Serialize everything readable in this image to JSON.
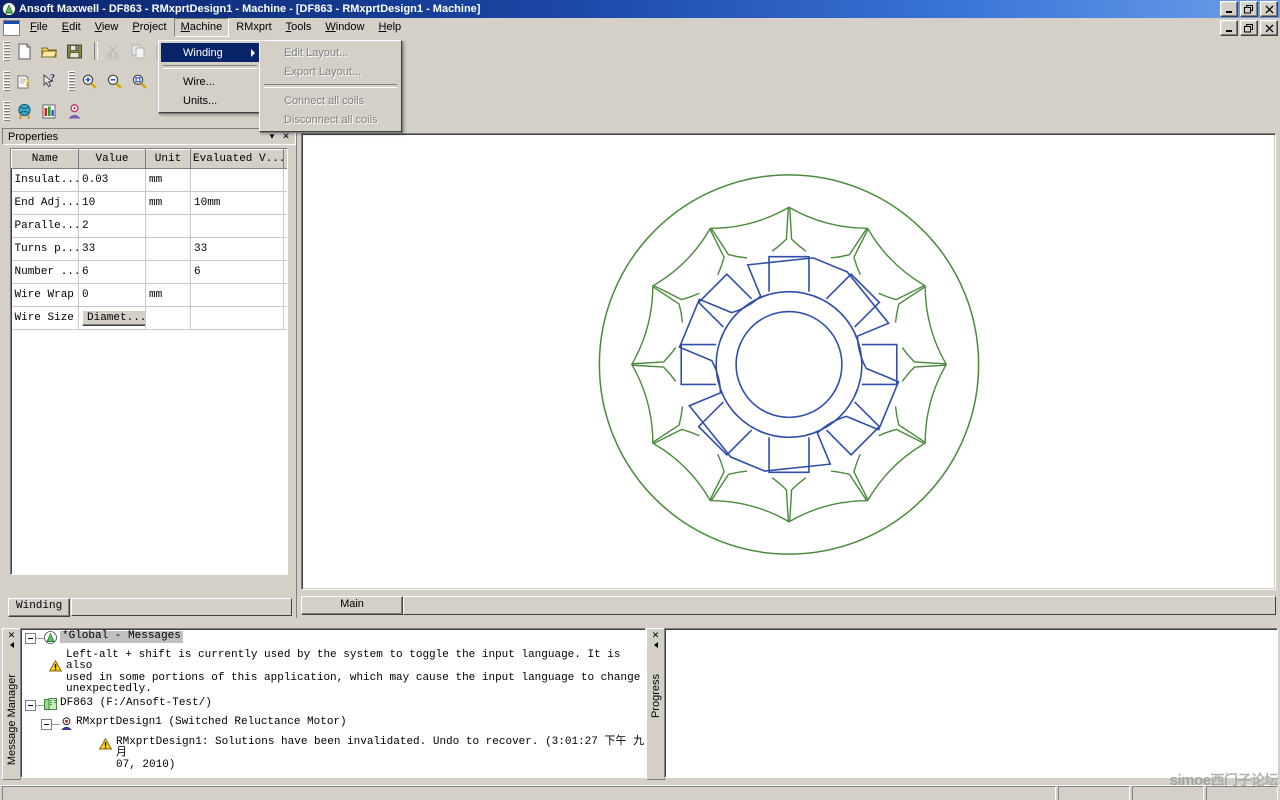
{
  "window": {
    "title": "Ansoft Maxwell - DF863 - RMxprtDesign1 - Machine - [DF863 - RMxprtDesign1 - Machine]",
    "app_icon": "ansoft-maxwell-icon",
    "minimize": "_",
    "maximize": "❐",
    "close": "✕"
  },
  "mdi": {
    "minimize": "_",
    "restore": "❐",
    "close": "✕",
    "doc_icon": "document-icon"
  },
  "menubar": {
    "items": [
      {
        "label": "File",
        "accel": "F",
        "state": "normal"
      },
      {
        "label": "Edit",
        "accel": "E",
        "state": "normal"
      },
      {
        "label": "View",
        "accel": "V",
        "state": "normal"
      },
      {
        "label": "Project",
        "accel": "P",
        "state": "normal"
      },
      {
        "label": "Machine",
        "accel": "M",
        "state": "open"
      },
      {
        "label": "RMxprt",
        "accel": "R",
        "state": "normal"
      },
      {
        "label": "Tools",
        "accel": "T",
        "state": "normal"
      },
      {
        "label": "Window",
        "accel": "W",
        "state": "normal"
      },
      {
        "label": "Help",
        "accel": "H",
        "state": "normal"
      }
    ]
  },
  "machine_menu": {
    "items": [
      {
        "label": "Winding",
        "selected": true,
        "has_submenu": true,
        "disabled": false
      },
      {
        "separator": true
      },
      {
        "label": "Wire...",
        "selected": false,
        "has_submenu": false,
        "disabled": false
      },
      {
        "label": "Units...",
        "selected": false,
        "has_submenu": false,
        "disabled": false
      }
    ]
  },
  "winding_submenu": {
    "items": [
      {
        "label": "Edit Layout...",
        "disabled": true
      },
      {
        "label": "Export Layout...",
        "disabled": true
      },
      {
        "separator": true
      },
      {
        "label": "Connect all coils",
        "disabled": true
      },
      {
        "label": "Disconnect all coils",
        "disabled": true
      }
    ]
  },
  "toolbars": {
    "row1": [
      {
        "group": 1,
        "icons": [
          "new-document-icon",
          "open-folder-icon",
          "save-disk-icon"
        ]
      },
      {
        "group": 2,
        "icons": [
          "cut-scissors-icon",
          "copy-icon",
          "paste-icon"
        ]
      }
    ],
    "row2": [
      {
        "group": 1,
        "icons": [
          "help-context-icon",
          "help-pointer-icon"
        ]
      },
      {
        "group": 2,
        "icons": [
          "zoom-in-icon",
          "zoom-out-icon",
          "zoom-fit-icon"
        ]
      },
      {
        "group": 3,
        "icons": [
          "validate-check-icon",
          "analyze-icon",
          "analyze-all-icon",
          "edit-notes-icon",
          "copy-report-icon",
          "flag-icon"
        ]
      }
    ],
    "row3": [
      {
        "group": 1,
        "icons": [
          "model-icon",
          "results-icon",
          "user-defined-icon"
        ]
      }
    ]
  },
  "properties": {
    "caption": "Properties",
    "collapse_glyph": "▾",
    "close_glyph": "✕",
    "columns": [
      "Name",
      "Value",
      "Unit",
      "Evaluated V..."
    ],
    "rows": [
      {
        "name": "Insulat...",
        "value": "0.03",
        "unit": "mm",
        "evaluated": "",
        "is_button": false
      },
      {
        "name": "End Adj...",
        "value": "10",
        "unit": "mm",
        "evaluated": "10mm",
        "is_button": false
      },
      {
        "name": "Paralle...",
        "value": "2",
        "unit": "",
        "evaluated": "",
        "is_button": false
      },
      {
        "name": "Turns p...",
        "value": "33",
        "unit": "",
        "evaluated": "33",
        "is_button": false
      },
      {
        "name": "Number ...",
        "value": "6",
        "unit": "",
        "evaluated": "6",
        "is_button": false
      },
      {
        "name": "Wire Wrap",
        "value": "0",
        "unit": "mm",
        "evaluated": "",
        "is_button": false
      },
      {
        "name": "Wire Size",
        "value": "Diamet...",
        "unit": "",
        "evaluated": "",
        "is_button": true
      }
    ],
    "tab": "Winding"
  },
  "document": {
    "tab": "Main",
    "drawing": {
      "name": "switched-reluctance-motor-cross-section",
      "stator_color": "#4a8a3c",
      "rotor_color": "#2f4fa8",
      "background": "#ffffff",
      "stator_teeth": 12,
      "rotor_poles": 8,
      "outer_radius": 190,
      "stator_yoke_inner_radius": 152,
      "stator_bore_radius": 112,
      "rotor_outer_radius": 108,
      "rotor_pole_radius": 73,
      "shaft_radius": 53
    }
  },
  "message_manager": {
    "side_label": "Message Manager",
    "close_glyph": "✕",
    "tree": [
      {
        "level": 0,
        "type": "root",
        "icon": "ansoft-globe-icon",
        "label": "*Global - Messages",
        "selected": true
      },
      {
        "level": 1,
        "type": "warning",
        "icon": "warning-triangle-icon",
        "lines": [
          "Left-alt + shift is currently used by the system to toggle the input language. It is also",
          "used in some portions of this application, which may cause the input language to change",
          "unexpectedly."
        ]
      },
      {
        "level": 0,
        "type": "project",
        "icon": "project-icon",
        "label": "DF863 (F:/Ansoft-Test/)",
        "selected": false
      },
      {
        "level": 1,
        "type": "design",
        "icon": "rmxprt-design-icon",
        "label": "RMxprtDesign1 (Switched Reluctance Motor)",
        "selected": false
      },
      {
        "level": 2,
        "type": "warning",
        "icon": "warning-triangle-icon",
        "lines": [
          "RMxprtDesign1: Solutions have been invalidated. Undo to recover. (3:01:27 下午  九月",
          "07, 2010)"
        ]
      }
    ]
  },
  "progress": {
    "side_label": "Progress",
    "close_glyph": "✕"
  },
  "statusbar": {
    "text": ""
  },
  "watermark": {
    "latin": "simoe",
    "cjk": "西门子论坛"
  },
  "colors": {
    "title_gradient_start": "#0a246a",
    "title_gradient_end": "#6b9fe8",
    "face": "#d4d0c8",
    "menu_highlight": "#0a246a",
    "stator_green": "#4a8a3c",
    "rotor_blue": "#2f4fa8"
  }
}
